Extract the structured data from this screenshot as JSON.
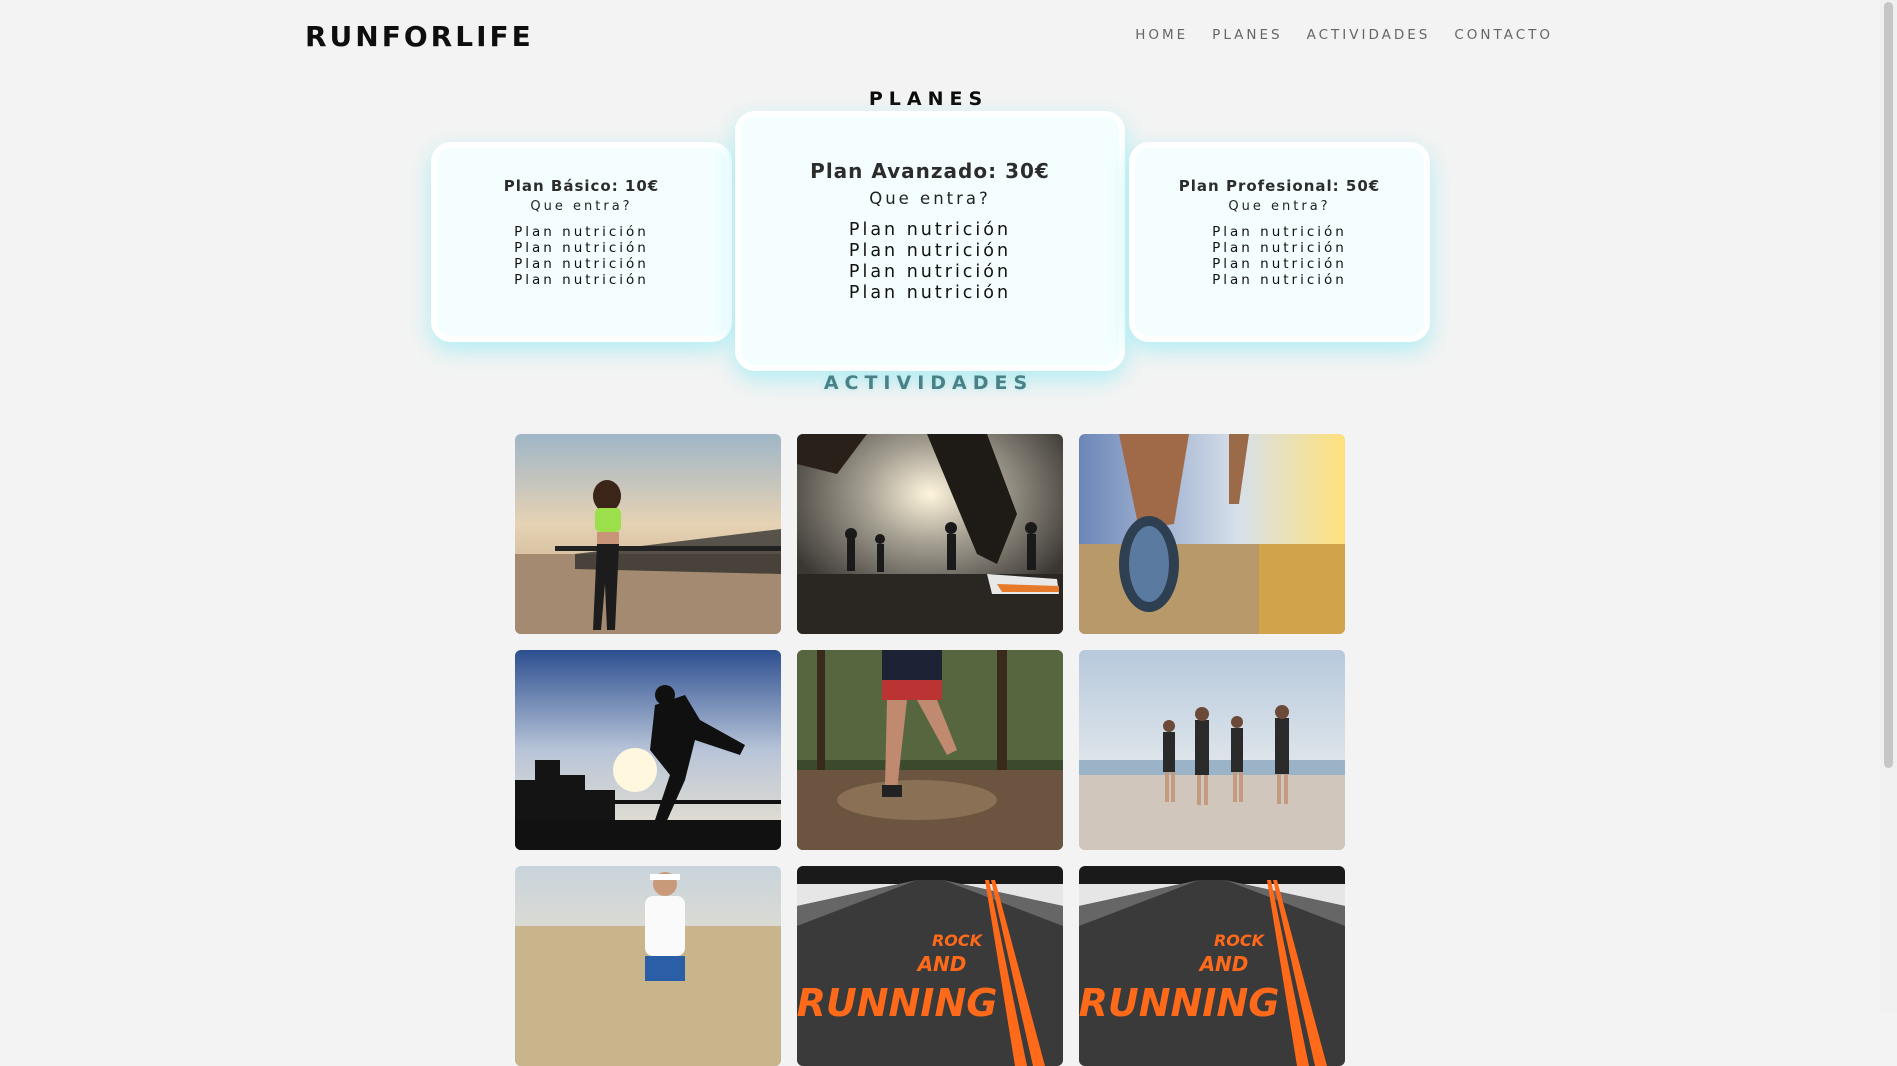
{
  "brand": "RUNFORLIFE",
  "nav": [
    "HOME",
    "PLANES",
    "ACTIVIDADES",
    "CONTACTO"
  ],
  "planes": {
    "title": "PLANES",
    "cards": [
      {
        "title": "Plan Básico: 10€",
        "subtitle": "Que entra?",
        "items": [
          "Plan nutrición",
          "Plan nutrición",
          "Plan nutrición",
          "Plan nutrición"
        ]
      },
      {
        "title": "Plan Avanzado: 30€",
        "subtitle": "Que entra?",
        "items": [
          "Plan nutrición",
          "Plan nutrición",
          "Plan nutrición",
          "Plan nutrición"
        ]
      },
      {
        "title": "Plan Profesional: 50€",
        "subtitle": "Que entra?",
        "items": [
          "Plan nutrición",
          "Plan nutrición",
          "Plan nutrición",
          "Plan nutrición"
        ]
      }
    ]
  },
  "actividades": {
    "title": "ACTIVIDADES",
    "photos": [
      {
        "name": "woman-running-boardwalk-photo"
      },
      {
        "name": "group-running-sunset-photo"
      },
      {
        "name": "running-shoes-closeup-photo"
      },
      {
        "name": "silhouette-runner-city-photo"
      },
      {
        "name": "trail-runner-forest-photo"
      },
      {
        "name": "group-running-seaside-photo"
      },
      {
        "name": "runner-field-photo"
      },
      {
        "name": "rock-and-running-road-photo"
      },
      {
        "name": "rock-and-running-road-photo-2"
      }
    ],
    "road_text": [
      "ROCK",
      "AND",
      "RUNNING"
    ]
  },
  "colors": {
    "accent_glow": "#7febf5",
    "card_bg": "#f4fefe",
    "background": "#f3f3f3",
    "road_text": "#ff6a1a"
  }
}
